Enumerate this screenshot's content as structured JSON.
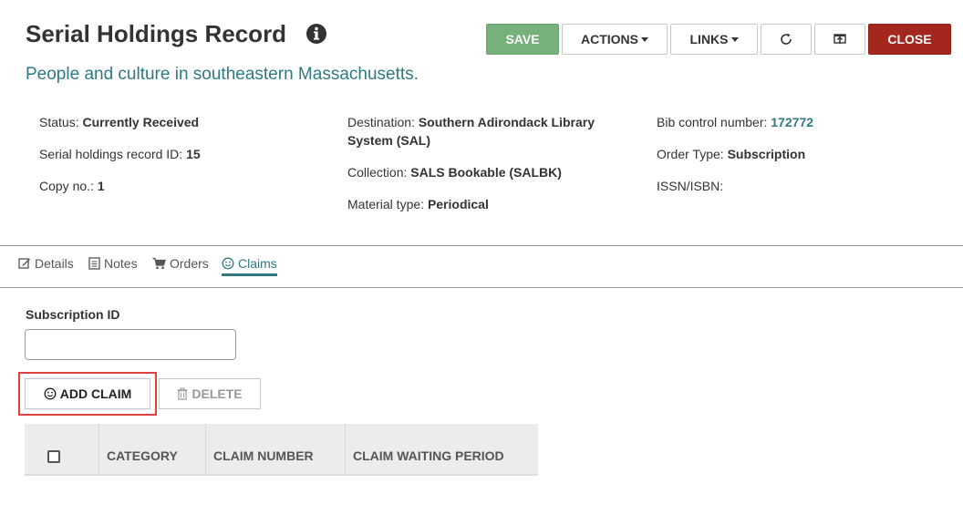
{
  "header": {
    "title": "Serial Holdings Record",
    "subtitle": "People and culture in southeastern Massachusetts."
  },
  "toolbar": {
    "save_label": "SAVE",
    "actions_label": "ACTIONS",
    "links_label": "LINKS",
    "close_label": "CLOSE"
  },
  "summary": {
    "status_label": "Status:",
    "status_value": "Currently Received",
    "record_id_label": "Serial holdings record ID:",
    "record_id_value": "15",
    "copy_label": "Copy no.:",
    "copy_value": "1",
    "destination_label": "Destination:",
    "destination_value_line1": "Southern Adirondack Library",
    "destination_value_line2": "System (SAL)",
    "collection_label": "Collection:",
    "collection_value": "SALS Bookable (SALBK)",
    "material_label": "Material type:",
    "material_value": "Periodical",
    "bib_label": "Bib control number:",
    "bib_value": "172772",
    "order_type_label": "Order Type:",
    "order_type_value": "Subscription",
    "issn_label": "ISSN/ISBN:"
  },
  "tabs": [
    {
      "label": "Details"
    },
    {
      "label": "Notes"
    },
    {
      "label": "Orders"
    },
    {
      "label": "Claims"
    }
  ],
  "claims": {
    "subscription_label": "Subscription ID",
    "subscription_value": "",
    "add_claim_label": "ADD CLAIM",
    "delete_label": "DELETE",
    "columns": [
      "CATEGORY",
      "CLAIM NUMBER",
      "CLAIM WAITING PERIOD"
    ]
  },
  "colors": {
    "accent": "#2f7a82",
    "save": "#76b07a",
    "close": "#a3271d",
    "highlight": "#e04040"
  }
}
